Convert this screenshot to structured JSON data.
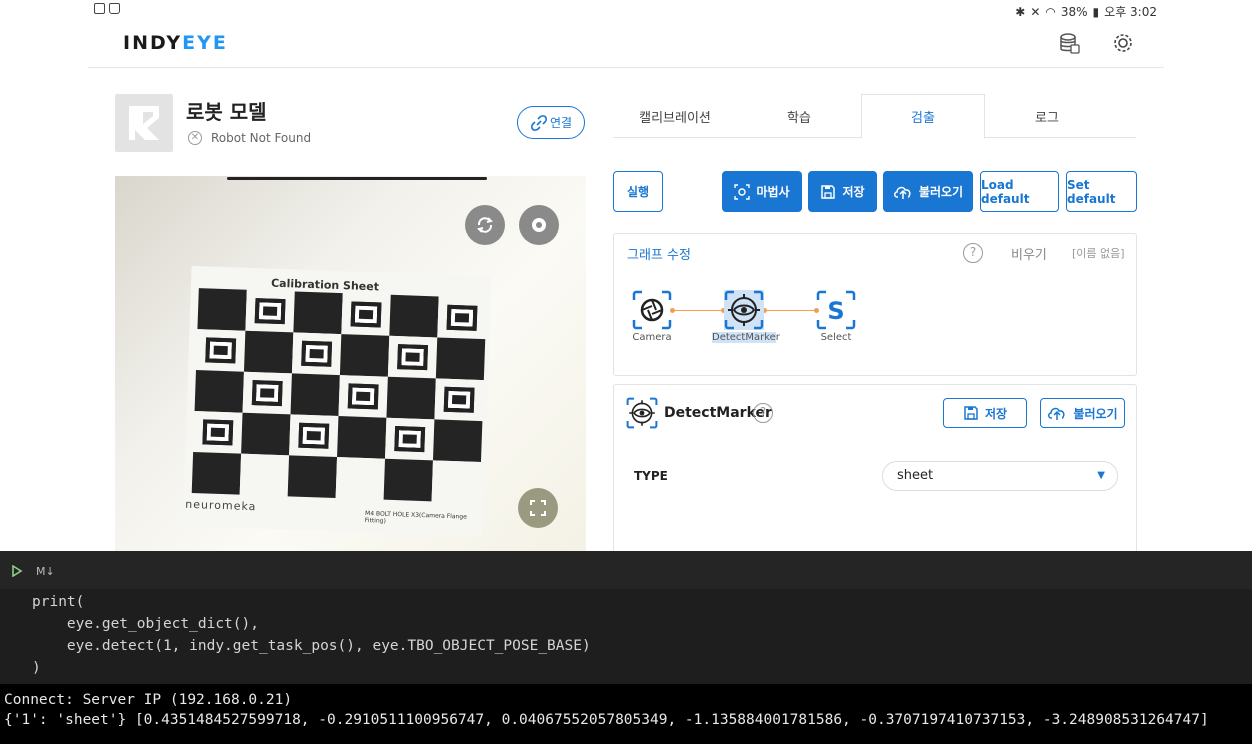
{
  "status_bar": {
    "battery": "38%",
    "time": "오후 3:02"
  },
  "app": {
    "logo_part1": "INDY",
    "logo_part2": "EYE"
  },
  "robot": {
    "title": "로봇 모델",
    "status": "Robot Not Found",
    "connect_label": "연결"
  },
  "tabs": [
    {
      "label": "캘리브레이션"
    },
    {
      "label": "학습"
    },
    {
      "label": "검출"
    },
    {
      "label": "로그"
    }
  ],
  "active_tab": "검출",
  "toolbar": {
    "run": "실행",
    "wizard": "마법사",
    "save": "저장",
    "load": "불러오기",
    "load_default": "Load default",
    "set_default": "Set default"
  },
  "graph": {
    "title": "그래프 수정",
    "clear": "비우기",
    "no_name": "[이름 없음]",
    "nodes": [
      {
        "label": "Camera",
        "icon": "camera-aperture-icon"
      },
      {
        "label": "DetectMarker",
        "icon": "eye-target-icon"
      },
      {
        "label": "Select",
        "icon": "select-s-icon"
      }
    ]
  },
  "detect_marker": {
    "title": "DetectMarker",
    "save": "저장",
    "load": "불러오기",
    "type_label": "TYPE",
    "type_value": "sheet"
  },
  "camera_view": {
    "sheet_title": "Calibration Sheet",
    "sheet_brand": "neuromeka",
    "sheet_footer": "M4 BOLT HOLE X3(Camera Flange Fitting)"
  },
  "notebook": {
    "cell_tag": "M↓",
    "code_lines": [
      "print(",
      "    eye.get_object_dict(),",
      "    eye.detect(1, indy.get_task_pos(), eye.TBO_OBJECT_POSE_BASE)",
      ")"
    ],
    "output_lines": [
      "Connect: Server IP (192.168.0.21)",
      "{'1': 'sheet'} [0.4351484527599718, -0.2910511100956747, 0.04067552057805349, -1.135884001781586, -0.3707197410737153, -3.248908531264747]"
    ]
  }
}
